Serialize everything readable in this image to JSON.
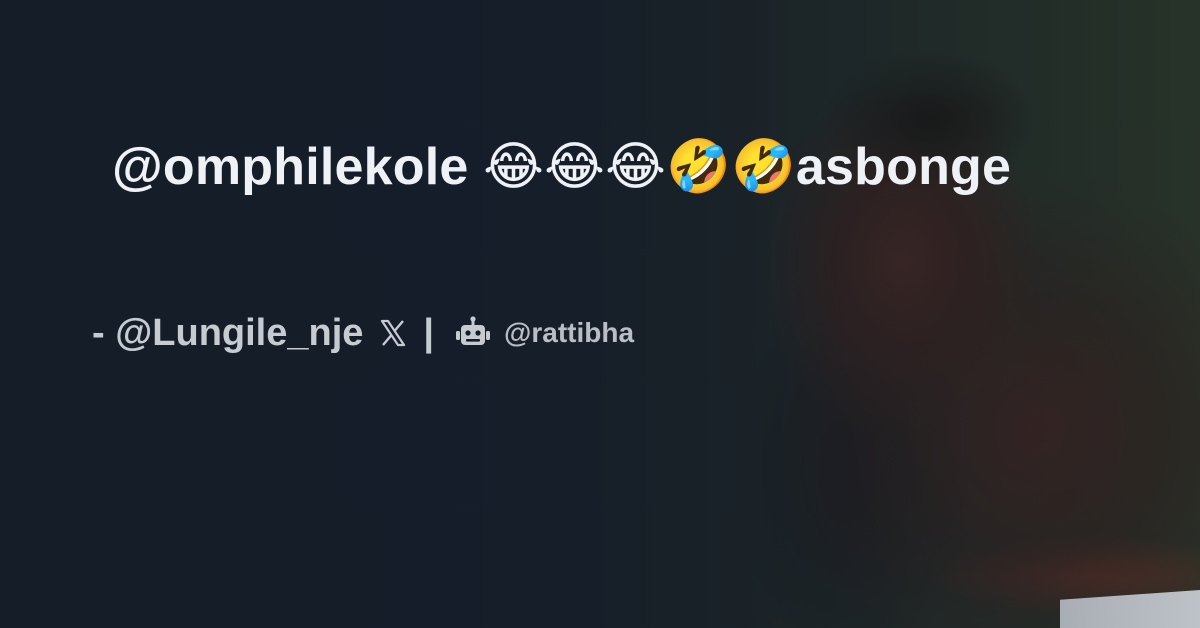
{
  "card": {
    "tweet_text": "@omphilekole 😂😂😂🤣🤣asbonge",
    "author_line": "- @Lungile_nje",
    "separator": "|",
    "site_handle": "@rattibha"
  },
  "icons": {
    "platform": "x-logo-icon",
    "site": "robot-icon"
  },
  "colors": {
    "background": "#151d29",
    "headline": "#eef1f5",
    "attribution": "#c6cbd2"
  }
}
